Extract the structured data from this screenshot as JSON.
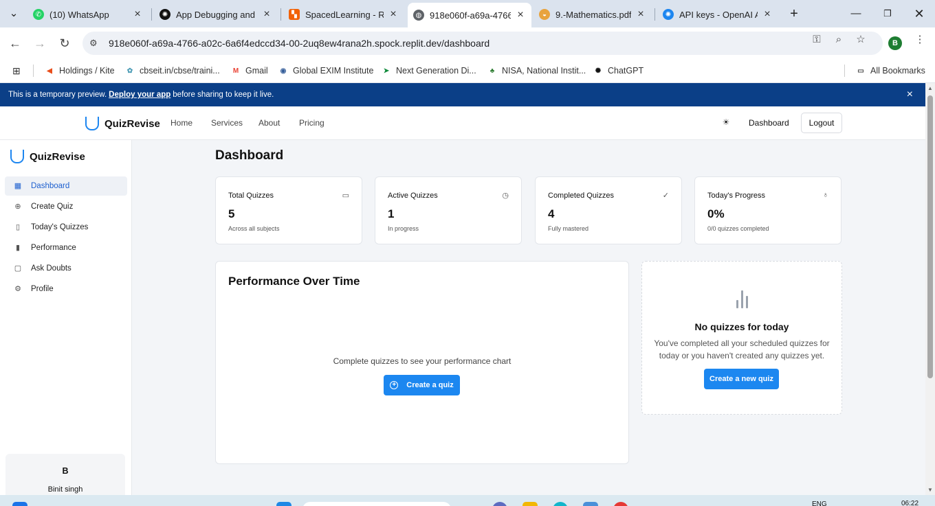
{
  "browser": {
    "tabs": [
      {
        "label": "(10) WhatsApp",
        "icon": "whatsapp-icon",
        "color": "#25d366"
      },
      {
        "label": "App Debugging and",
        "icon": "chatgpt-icon",
        "color": "#111111"
      },
      {
        "label": "SpacedLearning - Rep",
        "icon": "replit-icon",
        "color": "#f26207"
      },
      {
        "label": "918e060f-a69a-4766",
        "icon": "globe-icon",
        "color": "#5f6368"
      },
      {
        "label": "9.-Mathematics.pdf",
        "icon": "pdf-icon",
        "color": "#e8a33d"
      },
      {
        "label": "API keys - OpenAI AP",
        "icon": "openai-icon",
        "color": "#1d86f0"
      }
    ],
    "url": "918e060f-a69a-4766-a02c-6a6f4edccd34-00-2uq8ew4rana2h.spock.replit.dev/dashboard",
    "profile_initial": "B",
    "bookmarks": [
      {
        "label": "Holdings / Kite",
        "color": "#e94e1b"
      },
      {
        "label": "cbseit.in/cbse/traini...",
        "color": "#4a9bb5"
      },
      {
        "label": "Gmail",
        "color": "#ea4335"
      },
      {
        "label": "Global EXIM Institute",
        "color": "#355e9a"
      },
      {
        "label": "Next Generation Di...",
        "color": "#0e8a3a"
      },
      {
        "label": "NISA, National Instit...",
        "color": "#2e7d32"
      },
      {
        "label": "ChatGPT",
        "color": "#111111"
      }
    ],
    "all_bookmarks": "All Bookmarks"
  },
  "banner": {
    "prefix": "This is a temporary preview.",
    "link": "Deploy your app",
    "suffix": "before sharing to keep it live."
  },
  "app": {
    "brand": "QuizRevise",
    "nav": {
      "home": "Home",
      "services": "Services",
      "about": "About",
      "pricing": "Pricing",
      "dashboard": "Dashboard",
      "logout": "Logout"
    },
    "sidebar": {
      "brand": "QuizRevise",
      "items": [
        {
          "label": "Dashboard",
          "icon": "grid-icon"
        },
        {
          "label": "Create Quiz",
          "icon": "plus-circle-icon"
        },
        {
          "label": "Today's Quizzes",
          "icon": "book-icon"
        },
        {
          "label": "Performance",
          "icon": "bar-chart-icon"
        },
        {
          "label": "Ask Doubts",
          "icon": "message-icon"
        },
        {
          "label": "Profile",
          "icon": "settings-icon"
        }
      ],
      "user": {
        "initial": "B",
        "name": "Binit singh"
      }
    },
    "page_title": "Dashboard",
    "stats": [
      {
        "title": "Total Quizzes",
        "value": "5",
        "sub": "Across all subjects",
        "icon": "book-icon"
      },
      {
        "title": "Active Quizzes",
        "value": "1",
        "sub": "In progress",
        "icon": "clock-icon"
      },
      {
        "title": "Completed Quizzes",
        "value": "4",
        "sub": "Fully mastered",
        "icon": "check-icon"
      },
      {
        "title": "Today's Progress",
        "value": "0%",
        "sub": "0/0 quizzes completed",
        "icon": "award-icon"
      }
    ],
    "performance": {
      "title": "Performance Over Time",
      "empty_text": "Complete quizzes to see your performance chart",
      "button": "Create a quiz"
    },
    "today": {
      "title": "No quizzes for today",
      "description": "You've completed all your scheduled quizzes for today or you haven't created any quizzes yet.",
      "button": "Create a new quiz"
    }
  },
  "taskbar": {
    "lang": "ENG",
    "time": "06:22"
  },
  "colors": {
    "accent": "#1c87f0",
    "banner": "#0b3f87",
    "active_nav": "#1d5fcf"
  }
}
